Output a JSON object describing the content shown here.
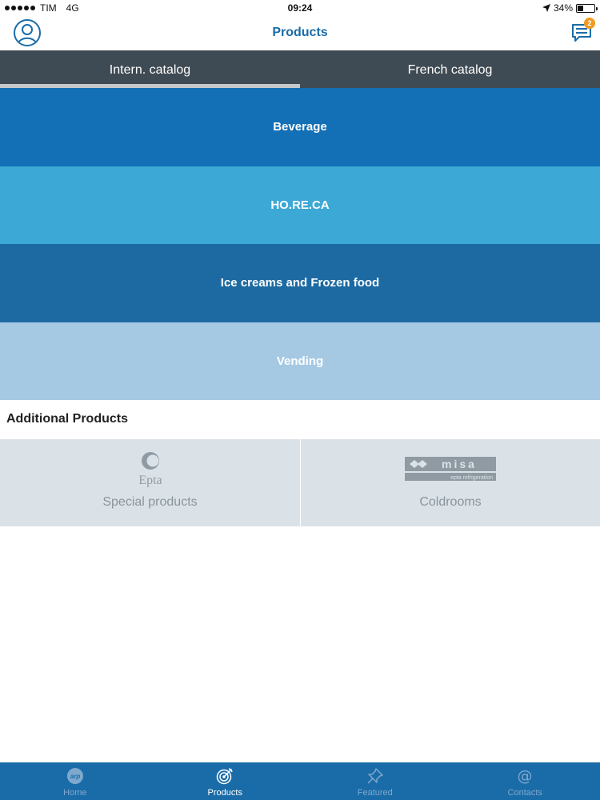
{
  "status_bar": {
    "carrier": "TIM",
    "network": "4G",
    "time": "09:24",
    "battery": "34%",
    "battery_level": 0.34
  },
  "header": {
    "title": "Products",
    "messages_badge": "2"
  },
  "tabs": [
    {
      "label": "Intern. catalog",
      "active": true
    },
    {
      "label": "French catalog",
      "active": false
    }
  ],
  "categories": [
    {
      "label": "Beverage",
      "color": "#136fb6"
    },
    {
      "label": "HO.RE.CA",
      "color": "#3ba8d6"
    },
    {
      "label": "Ice creams and Frozen food",
      "color": "#1d6aa2"
    },
    {
      "label": "Vending",
      "color": "#a5c9e3"
    }
  ],
  "additional": {
    "title": "Additional Products",
    "items": [
      {
        "label": "Special products",
        "logo_text": "Epta"
      },
      {
        "label": "Coldrooms",
        "logo_text": "misa",
        "logo_subtext": "epta refrigeration"
      }
    ]
  },
  "bottom_tabs": [
    {
      "label": "Home",
      "icon": "home-logo-icon",
      "active": false
    },
    {
      "label": "Products",
      "icon": "target-icon",
      "active": true
    },
    {
      "label": "Featured",
      "icon": "pin-icon",
      "active": false
    },
    {
      "label": "Contacts",
      "icon": "at-icon",
      "active": false
    }
  ],
  "colors": {
    "accent": "#1a6ca8",
    "tab_bar_bg": "#3f4b54",
    "badge": "#f09a1e",
    "additional_bg": "#dbe2e7"
  }
}
